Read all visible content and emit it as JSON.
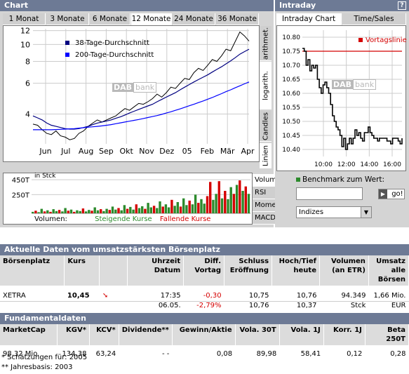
{
  "chart_panel": {
    "title": "Chart",
    "tabs": [
      "1 Monat",
      "3 Monate",
      "6 Monate",
      "12 Monate",
      "24 Monate",
      "36 Monate"
    ],
    "active_tab": "12 Monate",
    "scale_tabs": [
      "arithmet.",
      "logarith.",
      "Candles",
      "Linien"
    ],
    "legend": [
      "38-Tage-Durchschnitt",
      "200-Tage-Durchschnitt"
    ],
    "legend_colors": [
      "#000080",
      "#0000ff"
    ],
    "watermark": [
      "DAB",
      "bank"
    ],
    "volume_label": "in Stck",
    "volume_footer": {
      "prefix": "Volumen:",
      "rising": "Steigende Kurse",
      "falling": "Fallende Kurse"
    },
    "indicator_tabs": [
      "Volumen",
      "RSI",
      "Momentum",
      "MACD"
    ]
  },
  "benchmark": {
    "label": "Benchmark zum Wert:",
    "go_label": "go!",
    "select_value": "Indizes"
  },
  "intraday_panel": {
    "title": "Intraday",
    "help": "?",
    "tabs": [
      "Intraday Chart",
      "Time/Sales"
    ],
    "active_tab": "Intraday Chart",
    "legend": "Vortagslinie"
  },
  "chart_data": [
    {
      "type": "line",
      "title": "12 Monate",
      "scale": "log",
      "y_ticks": [
        4,
        6,
        8,
        10,
        12
      ],
      "ylim": [
        2.7,
        12.3
      ],
      "x_ticks": [
        "Jun",
        "Jul",
        "Aug",
        "Sep",
        "Okt",
        "Nov",
        "Dez",
        "05",
        "Feb",
        "Mär",
        "Apr"
      ],
      "series": [
        {
          "name": "Kurs",
          "color": "#000000",
          "values": [
            3.5,
            3.45,
            3.25,
            3.1,
            3.05,
            3.2,
            3.0,
            2.95,
            2.85,
            2.9,
            3.1,
            3.2,
            3.4,
            3.55,
            3.7,
            3.6,
            3.7,
            3.8,
            3.9,
            4.1,
            4.3,
            4.2,
            4.4,
            4.6,
            4.55,
            4.7,
            4.9,
            5.2,
            5.0,
            5.3,
            5.7,
            5.6,
            6.0,
            6.4,
            6.3,
            6.9,
            7.3,
            7.1,
            7.6,
            8.2,
            8.0,
            8.6,
            9.4,
            9.2,
            10.4,
            11.8,
            11.2,
            10.45
          ]
        },
        {
          "name": "38-Tage-Durchschnitt",
          "color": "#000080",
          "values": [
            3.9,
            3.8,
            3.7,
            3.55,
            3.45,
            3.4,
            3.35,
            3.3,
            3.28,
            3.28,
            3.3,
            3.35,
            3.4,
            3.48,
            3.55,
            3.6,
            3.65,
            3.7,
            3.78,
            3.85,
            3.95,
            4.05,
            4.15,
            4.25,
            4.35,
            4.45,
            4.55,
            4.7,
            4.85,
            5.0,
            5.15,
            5.3,
            5.5,
            5.7,
            5.9,
            6.1,
            6.3,
            6.5,
            6.7,
            6.95,
            7.2,
            7.45,
            7.75,
            8.05,
            8.4,
            8.8,
            9.1,
            9.4
          ]
        },
        {
          "name": "200-Tage-Durchschnitt",
          "color": "#0000ff",
          "values": [
            3.25,
            3.25,
            3.25,
            3.25,
            3.25,
            3.26,
            3.27,
            3.28,
            3.29,
            3.3,
            3.32,
            3.34,
            3.36,
            3.38,
            3.4,
            3.42,
            3.45,
            3.48,
            3.52,
            3.56,
            3.6,
            3.64,
            3.68,
            3.72,
            3.77,
            3.82,
            3.87,
            3.92,
            3.98,
            4.05,
            4.12,
            4.2,
            4.28,
            4.37,
            4.46,
            4.55,
            4.65,
            4.75,
            4.86,
            4.97,
            5.1,
            5.23,
            5.37,
            5.5,
            5.65,
            5.8,
            5.95,
            6.1
          ]
        }
      ]
    },
    {
      "type": "bar",
      "title": "Volumen",
      "y_ticks": [
        "250T",
        "450T"
      ],
      "ylim": [
        0,
        460000
      ],
      "rising_color": "#2c8a2c",
      "falling_color": "#d40000",
      "values": [
        20000,
        35000,
        15000,
        60000,
        25000,
        40000,
        20000,
        55000,
        30000,
        45000,
        25000,
        70000,
        35000,
        50000,
        20000,
        40000,
        30000,
        65000,
        25000,
        45000,
        35000,
        80000,
        40000,
        55000,
        30000,
        60000,
        45000,
        90000,
        50000,
        70000,
        40000,
        110000,
        60000,
        85000,
        50000,
        120000,
        70000,
        95000,
        60000,
        140000,
        80000,
        100000,
        70000,
        160000,
        90000,
        120000,
        80000,
        180000,
        100000,
        150000,
        90000,
        200000,
        110000,
        170000,
        120000,
        250000,
        140000,
        190000,
        130000,
        230000,
        420000,
        180000,
        260000,
        430000,
        200000,
        300000,
        190000,
        350000,
        260000,
        380000,
        440000,
        300000,
        360000,
        260000
      ],
      "directions": [
        "u",
        "d",
        "u",
        "u",
        "d",
        "u",
        "d",
        "u",
        "u",
        "d",
        "u",
        "u",
        "d",
        "u",
        "d",
        "u",
        "u",
        "d",
        "u",
        "u",
        "d",
        "u",
        "u",
        "d",
        "u",
        "u",
        "d",
        "u",
        "u",
        "d",
        "u",
        "u",
        "d",
        "u",
        "u",
        "d",
        "u",
        "u",
        "d",
        "u",
        "u",
        "d",
        "u",
        "u",
        "d",
        "u",
        "u",
        "d",
        "u",
        "u",
        "d",
        "u",
        "u",
        "d",
        "u",
        "u",
        "d",
        "u",
        "u",
        "d",
        "d",
        "u",
        "u",
        "d",
        "u",
        "d",
        "u",
        "u",
        "d",
        "u",
        "d",
        "u",
        "d",
        "u"
      ]
    },
    {
      "type": "line",
      "title": "Intraday Chart",
      "y_ticks": [
        10.4,
        10.45,
        10.5,
        10.55,
        10.6,
        10.65,
        10.7,
        10.75,
        10.8
      ],
      "ylim": [
        10.375,
        10.825
      ],
      "x_ticks": [
        "10:00",
        "12:00",
        "14:00",
        "16:00"
      ],
      "reference_line": 10.75,
      "series": [
        {
          "name": "Kurs",
          "color": "#000000",
          "values": [
            10.76,
            10.75,
            10.7,
            10.72,
            10.68,
            10.7,
            10.69,
            10.7,
            10.65,
            10.62,
            10.6,
            10.63,
            10.64,
            10.62,
            10.6,
            10.56,
            10.52,
            10.5,
            10.48,
            10.47,
            10.45,
            10.41,
            10.44,
            10.4,
            10.42,
            10.44,
            10.42,
            10.44,
            10.47,
            10.45,
            10.46,
            10.44,
            10.43,
            10.46,
            10.46,
            10.48,
            10.46,
            10.45,
            10.44,
            10.44,
            10.43,
            10.44,
            10.44,
            10.44,
            10.44,
            10.43,
            10.43,
            10.42,
            10.44,
            10.44,
            10.44,
            10.43,
            10.42,
            10.44
          ]
        }
      ]
    }
  ],
  "current_data": {
    "title": "Aktuelle Daten vom umsatzstärksten Börsenplatz",
    "headers": [
      [
        "Börsenplatz",
        ""
      ],
      [
        "Kurs",
        ""
      ],
      [
        "",
        ""
      ],
      [
        "Uhrzeit",
        "Datum"
      ],
      [
        "Diff.",
        "Vortag"
      ],
      [
        "Schluss",
        "Eröffnung"
      ],
      [
        "Hoch/Tief",
        "heute"
      ],
      [
        "Volumen",
        "(an ETR)"
      ],
      [
        "Umsatz",
        "alle Börsen"
      ]
    ],
    "row1": [
      "XETRA",
      "10,45",
      "",
      "17:35",
      "-0,30",
      "10,75",
      "10,76",
      "94.349",
      "1,66 Mio."
    ],
    "row2": [
      "",
      "",
      "",
      "06.05.",
      "-2,79%",
      "10,76",
      "10,37",
      "Stck",
      "EUR"
    ]
  },
  "fundamentals": {
    "title": "Fundamentaldaten",
    "headers": [
      "MarketCap",
      "KGV*",
      "KCV*",
      "Dividende**",
      "Gewinn/Aktie",
      "Vola. 30T",
      "Vola. 1J",
      "Korr. 1J",
      "Beta 250T"
    ],
    "row": [
      "98,32 Mio.",
      "134,38",
      "63,24",
      "- -",
      "0,08",
      "89,98",
      "58,41",
      "0,12",
      "0,28"
    ],
    "footnotes": [
      "* Schätzungen für: 2005",
      "** Jahresbasis: 2003"
    ]
  }
}
